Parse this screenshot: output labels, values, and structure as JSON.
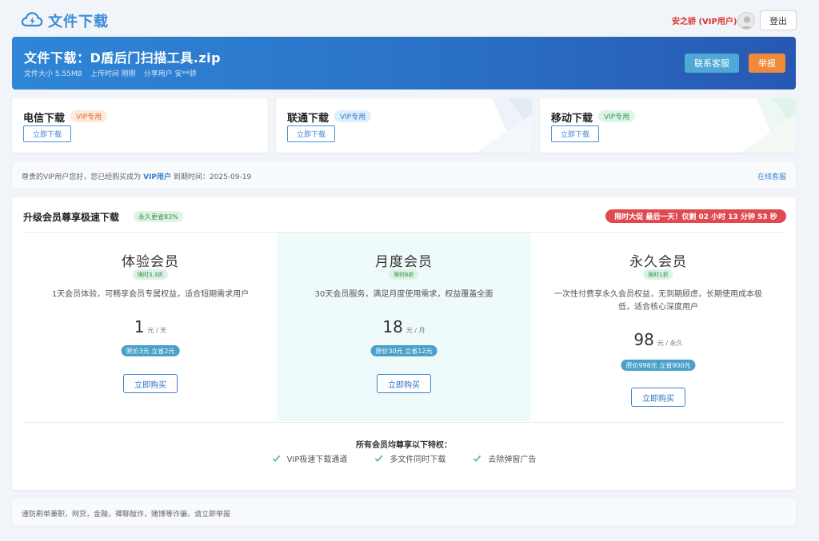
{
  "header": {
    "logo_text": "文件下载",
    "user_name": "安之骄 (VIP用户)",
    "logout_label": "登出"
  },
  "banner": {
    "title": "文件下载：D盾后门扫描工具.zip",
    "file_size": "文件大小 5.55MB",
    "upload_time": "上传时间 刚刚",
    "share_user": "分享用户 安**骄",
    "contact_label": "联系客服",
    "report_label": "举报"
  },
  "downloads": [
    {
      "title": "电信下载",
      "tag": "VIP专用",
      "button": "立即下载",
      "tag_color": "#e46a2c"
    },
    {
      "title": "联通下载",
      "tag": "VIP专用",
      "button": "立即下载",
      "tag_color": "#2f7fc9"
    },
    {
      "title": "移动下载",
      "tag": "VIP专用",
      "button": "立即下载",
      "tag_color": "#2b9b5a"
    }
  ],
  "notice": {
    "prefix": "尊贵的VIP用户您好，您已经购买成为 ",
    "vip": "VIP用户",
    "suffix": " 到期时间：2025-09-19",
    "link": "在线客服"
  },
  "membership": {
    "title": "升级会员尊享极速下载",
    "save_tag": "永久更省83%",
    "promo": "限时大促 最后一天！仅剩 02 小时 13 分钟 53 秒",
    "plans": [
      {
        "name": "体验会员",
        "discount": "限时3.3折",
        "desc": "1天会员体验，可畅享会员专属权益，适合短期需求用户",
        "price": "1",
        "unit": "元 / 天",
        "original": "原价3元 立省2元",
        "button": "立即购买"
      },
      {
        "name": "月度会员",
        "discount": "限时6折",
        "desc": "30天会员服务，满足月度使用需求，权益覆盖全面",
        "price": "18",
        "unit": "元 / 月",
        "original": "原价30元 立省12元",
        "button": "立即购买"
      },
      {
        "name": "永久会员",
        "discount": "限时1折",
        "desc": "一次性付费享永久会员权益，无到期顾虑，长期使用成本极低，适合核心深度用户",
        "price": "98",
        "unit": "元 / 永久",
        "original": "原价998元 立省900元",
        "button": "立即购买"
      }
    ],
    "privilege_title": "所有会员均尊享以下特权：",
    "privileges": [
      "VIP极速下载通道",
      "多文件同时下载",
      "去除弹窗广告"
    ]
  },
  "footer": {
    "warning": "谨防刷单兼职，网贷，金融，裸聊敲诈，赌博等诈骗，请立即举报"
  }
}
